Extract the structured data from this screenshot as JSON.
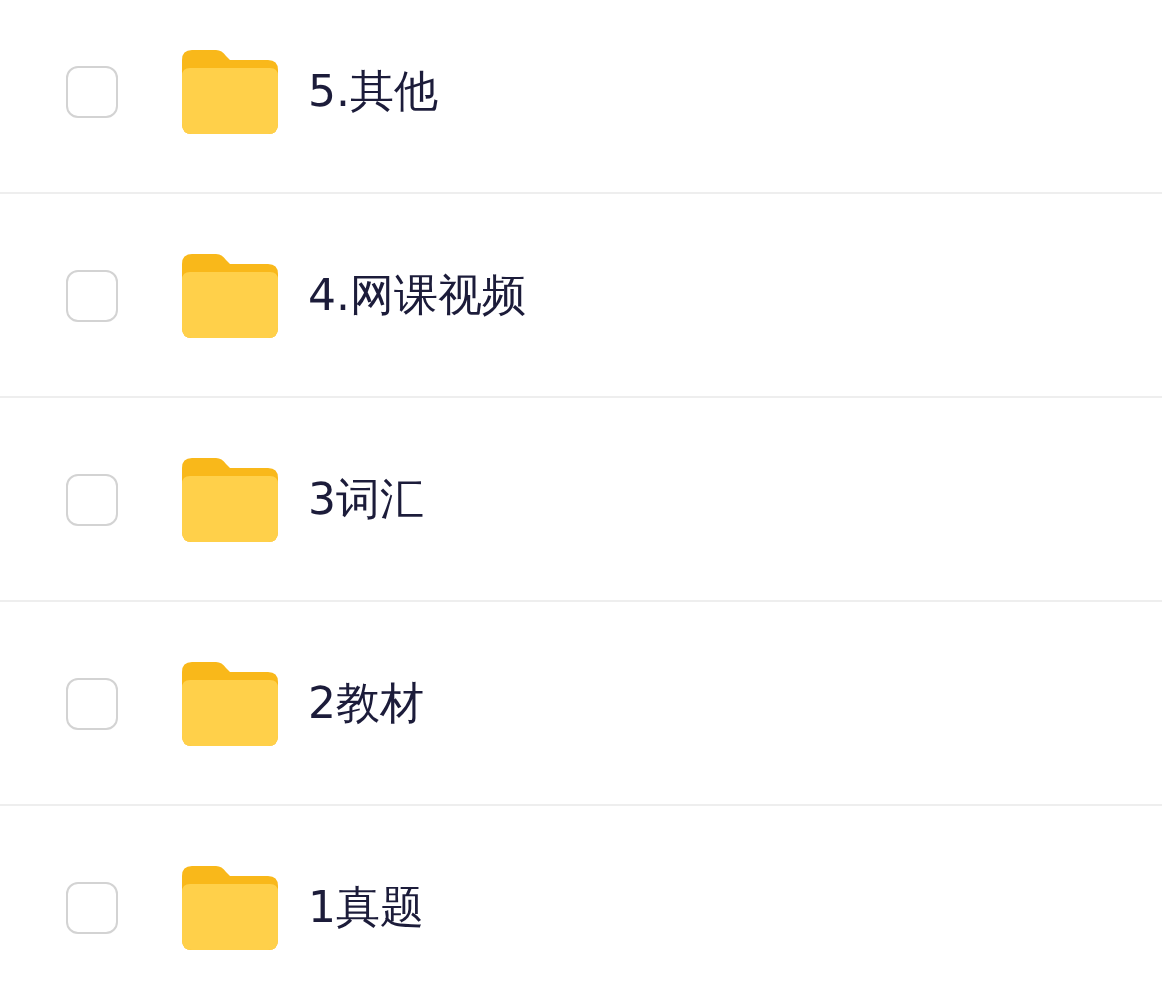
{
  "files": [
    {
      "name": "5.其他",
      "checked": false
    },
    {
      "name": "4.网课视频",
      "checked": false
    },
    {
      "name": "3词汇",
      "checked": false
    },
    {
      "name": "2教材",
      "checked": false
    },
    {
      "name": "1真题",
      "checked": false
    }
  ]
}
